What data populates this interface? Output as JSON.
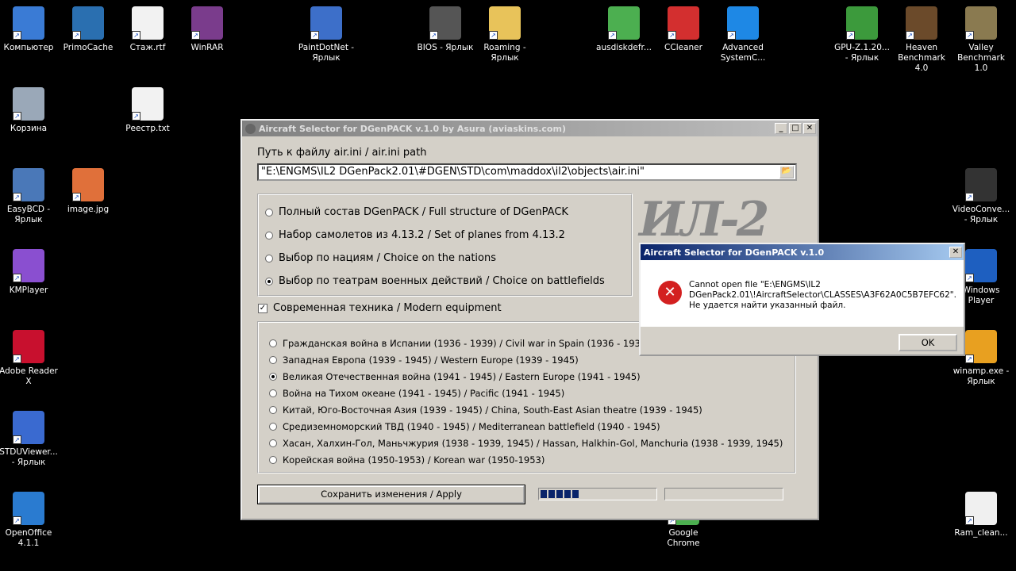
{
  "desktop_icons": [
    {
      "label": "Компьютер",
      "icon": "computer-icon",
      "color": "#3a7bd5"
    },
    {
      "label": "PrimoCache",
      "icon": "ram-icon",
      "color": "#2a6fb0"
    },
    {
      "label": "Стаж.rtf",
      "icon": "document-icon",
      "color": "#f2f2f2"
    },
    {
      "label": "WinRAR",
      "icon": "winrar-icon",
      "color": "#7a3c8c"
    },
    {
      "label": "PaintDotNet - Ярлык",
      "icon": "paint-icon",
      "color": "#3d6fc9"
    },
    {
      "label": "BIOS - Ярлык",
      "icon": "chip-icon",
      "color": "#555"
    },
    {
      "label": "Roaming - Ярлык",
      "icon": "folder-icon",
      "color": "#e8c35a"
    },
    {
      "label": "ausdiskdefr...",
      "icon": "defrag-icon",
      "color": "#4caf50"
    },
    {
      "label": "CCleaner",
      "icon": "ccleaner-icon",
      "color": "#d32f2f"
    },
    {
      "label": "Advanced SystemC...",
      "icon": "advanced-systemcare-icon",
      "color": "#1e88e5"
    },
    {
      "label": "GPU-Z.1.20... - Ярлык",
      "icon": "gpu-icon",
      "color": "#3c9a3c"
    },
    {
      "label": "Heaven Benchmark 4.0",
      "icon": "heaven-icon",
      "color": "#6b4a2a"
    },
    {
      "label": "Valley Benchmark 1.0",
      "icon": "valley-icon",
      "color": "#8a7a50"
    },
    {
      "label": "Корзина",
      "icon": "recycle-bin-icon",
      "color": "#9aa8b8"
    },
    {
      "label": "Реестр.txt",
      "icon": "text-file-icon",
      "color": "#f2f2f2"
    },
    {
      "label": "EasyBCD - Ярлык",
      "icon": "easybcd-icon",
      "color": "#4a78b8"
    },
    {
      "label": "image.jpg",
      "icon": "image-icon",
      "color": "#e0703a"
    },
    {
      "label": "VideoConve... - Ярлык",
      "icon": "video-icon",
      "color": "#333"
    },
    {
      "label": "KMPlayer",
      "icon": "kmplayer-icon",
      "color": "#8a4fd0"
    },
    {
      "label": "Windows Player",
      "icon": "media-player-icon",
      "color": "#1e5fc0"
    },
    {
      "label": "Adobe Reader X",
      "icon": "adobe-reader-icon",
      "color": "#c8102e"
    },
    {
      "label": "winamp.exe - Ярлык",
      "icon": "winamp-icon",
      "color": "#e8a020"
    },
    {
      "label": "STDUViewer... - Ярлык",
      "icon": "viewer-icon",
      "color": "#3a6ad0"
    },
    {
      "label": "OpenOffice 4.1.1",
      "icon": "openoffice-icon",
      "color": "#2a7bd0"
    },
    {
      "label": "Google Chrome",
      "icon": "chrome-icon",
      "color": "#4caf50"
    },
    {
      "label": "Ram_clean...",
      "icon": "ram-cleaner-icon",
      "color": "#f0f0f0"
    }
  ],
  "main_window": {
    "title": "Aircraft Selector for DGenPACK v.1.0 by Asura (aviaskins.com)",
    "path_label": "Путь к файлу air.ini / air.ini path",
    "path_value": "\"E:\\ENGMS\\IL2 DGenPack2.01\\#DGEN\\STD\\com\\maddox\\il2\\objects\\air.ini\"",
    "logo_text": "ИЛ-2",
    "modes": [
      {
        "label": "Полный состав DGenPACK / Full structure of DGenPACK",
        "selected": false
      },
      {
        "label": "Набор самолетов из 4.13.2 / Set of planes from 4.13.2",
        "selected": false
      },
      {
        "label": "Выбор по нациям / Choice on the nations",
        "selected": false
      },
      {
        "label": "Выбор по театрам военных действий / Choice on battlefields",
        "selected": true
      }
    ],
    "modern_equipment": {
      "label": "Современная техника / Modern equipment",
      "checked": true
    },
    "theatres": [
      {
        "label": "Гражданская война в Испании (1936 - 1939) / Civil war in Spain (1936 - 1939)",
        "selected": false
      },
      {
        "label": "Западная Европа (1939 - 1945) / Western Europe (1939 - 1945)",
        "selected": false
      },
      {
        "label": "Великая Отечественная война (1941 - 1945) / Eastern Europe (1941 - 1945)",
        "selected": true
      },
      {
        "label": "Война на Тихом океане (1941 - 1945) / Pacific (1941 - 1945)",
        "selected": false
      },
      {
        "label": "Китай, Юго-Восточная Азия (1939 - 1945) / China, South-East Asian theatre (1939 - 1945)",
        "selected": false
      },
      {
        "label": "Средиземноморский ТВД (1940 - 1945) / Mediterranean battlefield (1940 - 1945)",
        "selected": false
      },
      {
        "label": "Хасан, Халхин-Гол, Маньчжурия (1938 - 1939, 1945) / Hassan, Halkhin-Gol, Manchuria (1938 - 1939, 1945)",
        "selected": false
      },
      {
        "label": "Корейская война (1950-1953) / Korean war (1950-1953)",
        "selected": false
      }
    ],
    "apply_label": "Сохранить изменения / Apply",
    "progress_percent": 30
  },
  "error_dialog": {
    "title": "Aircraft Selector for DGenPACK v.1.0",
    "message_line1": "Cannot open file \"E:\\ENGMS\\IL2",
    "message_line2": "DGenPack2.01\\!AircraftSelector\\CLASSES\\A3F62A0C5B7EFC62\".",
    "message_line3": "Не удается найти указанный файл.",
    "ok_label": "OK"
  }
}
